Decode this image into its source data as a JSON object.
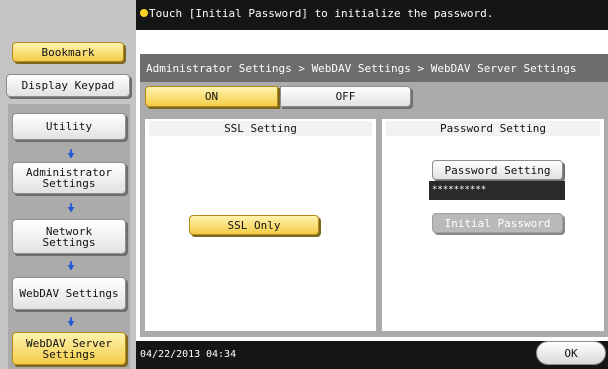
{
  "message": "Touch [Initial Password] to initialize the password.",
  "sidebar": {
    "bookmark": "Bookmark",
    "display_keypad": "Display Keypad",
    "utility": "Utility",
    "admin_line1": "Administrator",
    "admin_line2": "Settings",
    "network_line1": "Network",
    "network_line2": "Settings",
    "webdav": "WebDAV Settings",
    "server_line1": "WebDAV Server",
    "server_line2": "Settings"
  },
  "breadcrumb": "Administrator Settings > WebDAV Settings > WebDAV Server Settings",
  "toggle": {
    "on": "ON",
    "off": "OFF"
  },
  "ssl": {
    "header": "SSL Setting",
    "button": "SSL Only"
  },
  "password": {
    "header": "Password Setting",
    "button": "Password Setting",
    "value": "**********",
    "initial": "Initial Password"
  },
  "footer": {
    "date": "04/22/2013",
    "time": "04:34",
    "ok": "OK"
  },
  "colors": {
    "accent_yellow": "#f4cc47",
    "dark_bar": "#151515",
    "arrow_blue": "#2457d6"
  }
}
